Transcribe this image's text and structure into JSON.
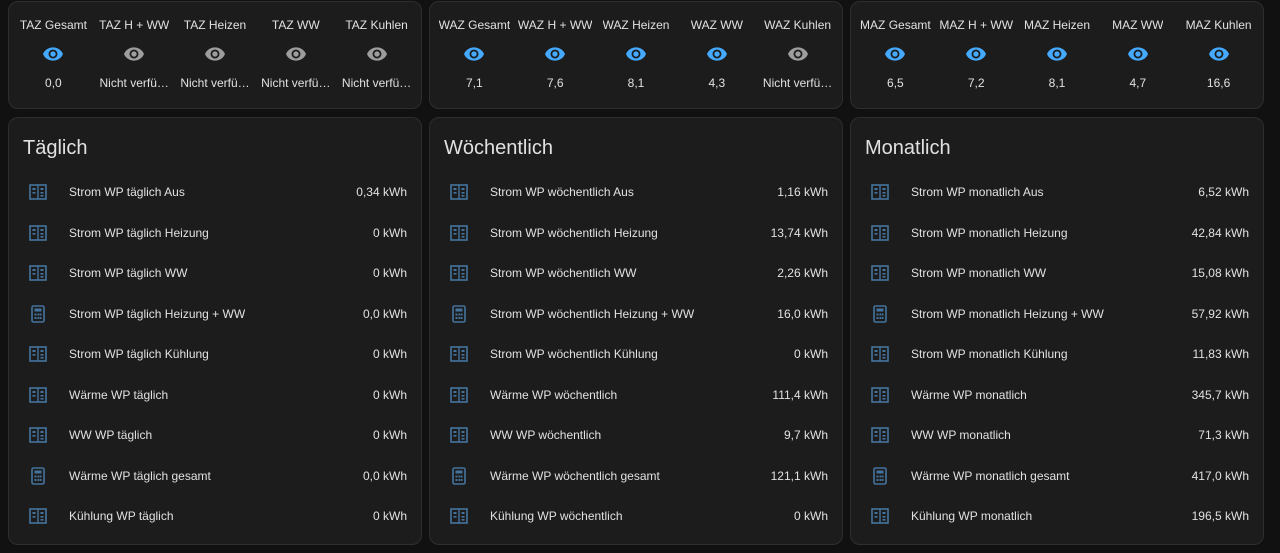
{
  "colors": {
    "background": "#111111",
    "card": "#1c1c1c",
    "accent": "#44a9ff",
    "icon_inactive": "#9d9d9d",
    "entity_icon": "#44739e"
  },
  "glance_cards": [
    {
      "items": [
        {
          "name": "TAZ Gesamt",
          "state": "0,0",
          "icon": "eye-icon",
          "active": true
        },
        {
          "name": "TAZ H + WW",
          "state": "Nicht verfü…",
          "icon": "eye-icon",
          "active": false
        },
        {
          "name": "TAZ Heizen",
          "state": "Nicht verfü…",
          "icon": "eye-icon",
          "active": false
        },
        {
          "name": "TAZ WW",
          "state": "Nicht verfü…",
          "icon": "eye-icon",
          "active": false
        },
        {
          "name": "TAZ Kuhlen",
          "state": "Nicht verfü…",
          "icon": "eye-icon",
          "active": false
        }
      ]
    },
    {
      "items": [
        {
          "name": "WAZ Gesamt",
          "state": "7,1",
          "icon": "eye-icon",
          "active": true
        },
        {
          "name": "WAZ H + WW",
          "state": "7,6",
          "icon": "eye-icon",
          "active": true
        },
        {
          "name": "WAZ Heizen",
          "state": "8,1",
          "icon": "eye-icon",
          "active": true
        },
        {
          "name": "WAZ WW",
          "state": "4,3",
          "icon": "eye-icon",
          "active": true
        },
        {
          "name": "WAZ Kuhlen",
          "state": "Nicht verfü…",
          "icon": "eye-icon",
          "active": false
        }
      ]
    },
    {
      "items": [
        {
          "name": "MAZ Gesamt",
          "state": "6,5",
          "icon": "eye-icon",
          "active": true
        },
        {
          "name": "MAZ H + WW",
          "state": "7,2",
          "icon": "eye-icon",
          "active": true
        },
        {
          "name": "MAZ Heizen",
          "state": "8,1",
          "icon": "eye-icon",
          "active": true
        },
        {
          "name": "MAZ WW",
          "state": "4,7",
          "icon": "eye-icon",
          "active": true
        },
        {
          "name": "MAZ Kuhlen",
          "state": "16,6",
          "icon": "eye-icon",
          "active": true
        }
      ]
    }
  ],
  "entity_cards": [
    {
      "title": "Täglich",
      "rows": [
        {
          "name": "Strom WP täglich Aus",
          "value": "0,34 kWh",
          "icon": "meter-icon"
        },
        {
          "name": "Strom WP täglich Heizung",
          "value": "0 kWh",
          "icon": "meter-icon"
        },
        {
          "name": "Strom WP täglich WW",
          "value": "0 kWh",
          "icon": "meter-icon"
        },
        {
          "name": "Strom WP täglich Heizung + WW",
          "value": "0,0 kWh",
          "icon": "calculator-icon"
        },
        {
          "name": "Strom WP täglich Kühlung",
          "value": "0 kWh",
          "icon": "meter-icon"
        },
        {
          "name": "Wärme WP täglich",
          "value": "0 kWh",
          "icon": "meter-icon"
        },
        {
          "name": "WW WP täglich",
          "value": "0 kWh",
          "icon": "meter-icon"
        },
        {
          "name": "Wärme WP täglich gesamt",
          "value": "0,0 kWh",
          "icon": "calculator-icon"
        },
        {
          "name": "Kühlung WP täglich",
          "value": "0 kWh",
          "icon": "meter-icon"
        }
      ]
    },
    {
      "title": "Wöchentlich",
      "rows": [
        {
          "name": "Strom WP wöchentlich Aus",
          "value": "1,16 kWh",
          "icon": "meter-icon"
        },
        {
          "name": "Strom WP wöchentlich Heizung",
          "value": "13,74 kWh",
          "icon": "meter-icon"
        },
        {
          "name": "Strom WP wöchentlich WW",
          "value": "2,26 kWh",
          "icon": "meter-icon"
        },
        {
          "name": "Strom WP wöchentlich Heizung + WW",
          "value": "16,0 kWh",
          "icon": "calculator-icon"
        },
        {
          "name": "Strom WP wöchentlich Kühlung",
          "value": "0 kWh",
          "icon": "meter-icon"
        },
        {
          "name": "Wärme WP wöchentlich",
          "value": "111,4 kWh",
          "icon": "meter-icon"
        },
        {
          "name": "WW WP wöchentlich",
          "value": "9,7 kWh",
          "icon": "meter-icon"
        },
        {
          "name": "Wärme WP wöchentlich gesamt",
          "value": "121,1 kWh",
          "icon": "calculator-icon"
        },
        {
          "name": "Kühlung WP wöchentlich",
          "value": "0 kWh",
          "icon": "meter-icon"
        }
      ]
    },
    {
      "title": "Monatlich",
      "rows": [
        {
          "name": "Strom WP monatlich Aus",
          "value": "6,52 kWh",
          "icon": "meter-icon"
        },
        {
          "name": "Strom WP monatlich Heizung",
          "value": "42,84 kWh",
          "icon": "meter-icon"
        },
        {
          "name": "Strom WP monatlich WW",
          "value": "15,08 kWh",
          "icon": "meter-icon"
        },
        {
          "name": "Strom WP monatlich Heizung + WW",
          "value": "57,92 kWh",
          "icon": "calculator-icon"
        },
        {
          "name": "Strom WP monatlich Kühlung",
          "value": "11,83 kWh",
          "icon": "meter-icon"
        },
        {
          "name": "Wärme WP monatlich",
          "value": "345,7 kWh",
          "icon": "meter-icon"
        },
        {
          "name": "WW WP monatlich",
          "value": "71,3 kWh",
          "icon": "meter-icon"
        },
        {
          "name": "Wärme WP monatlich gesamt",
          "value": "417,0 kWh",
          "icon": "calculator-icon"
        },
        {
          "name": "Kühlung WP monatlich",
          "value": "196,5 kWh",
          "icon": "meter-icon"
        }
      ]
    }
  ]
}
